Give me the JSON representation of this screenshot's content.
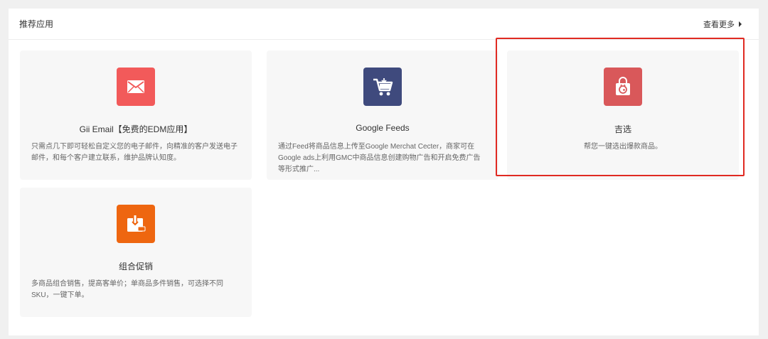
{
  "header": {
    "title": "推荐应用",
    "more_label": "查看更多"
  },
  "apps": [
    {
      "title": "Gii Email【免费的EDM应用】",
      "description": "只需点几下即可轻松自定义您的电子邮件，向精准的客户发送电子邮件，和每个客户建立联系，维护品牌认知度。",
      "icon": "envelope-icon",
      "color": "#f25a5a"
    },
    {
      "title": "Google Feeds",
      "description": "通过Feed将商品信息上传至Google Merchat Cecter，商家可在Google ads上利用GMC中商品信息创建购物广告和开启免费广告等形式推广...",
      "icon": "shopping-cart-icon",
      "color": "#3f4a7d"
    },
    {
      "title": "吉选",
      "description": "帮您一键选出爆款商品。",
      "icon": "shopping-bag-icon",
      "color": "#d9585a",
      "highlighted": true
    },
    {
      "title": "组合促销",
      "description": "多商品组合销售，提高客单价；单商品多件销售，可选择不同SKU，一键下单。",
      "icon": "gift-box-icon",
      "color": "#ee6610"
    }
  ],
  "colors": {
    "highlight_border": "#e02a22",
    "card_background": "#f7f7f7"
  }
}
